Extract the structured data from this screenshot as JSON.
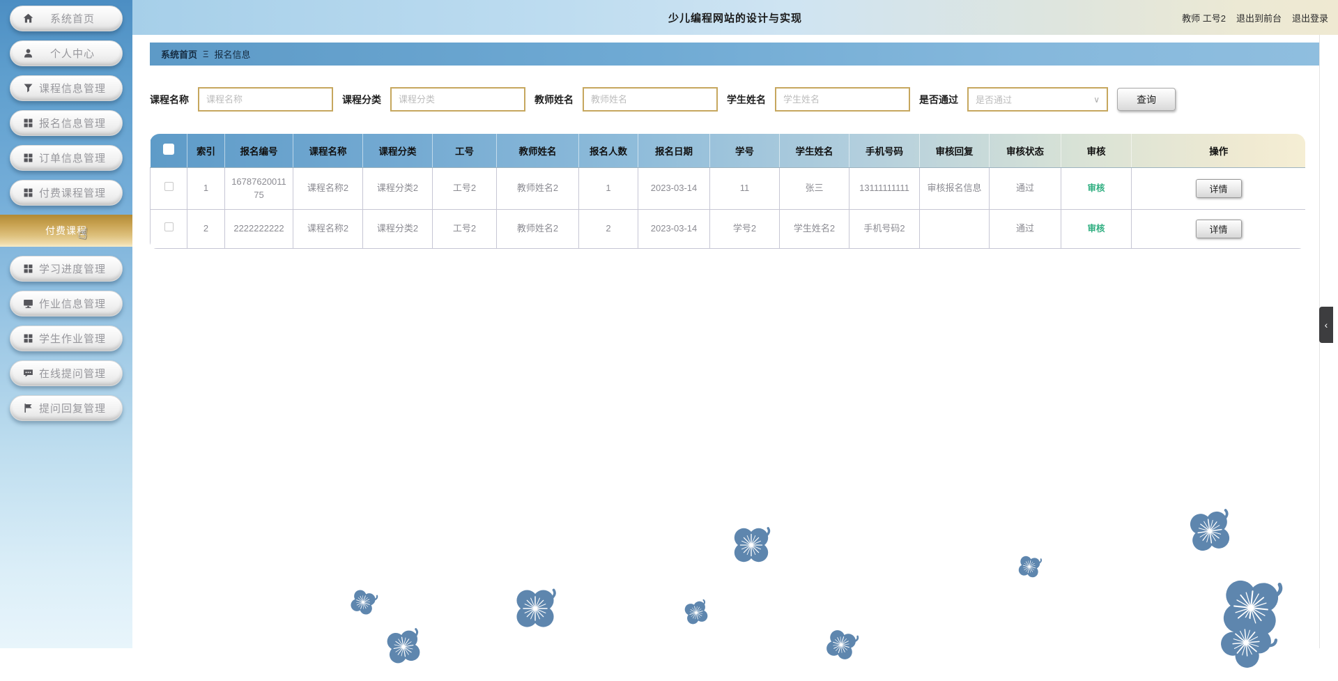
{
  "app": {
    "title": "少儿编程网站的设计与实现"
  },
  "header": {
    "user_label": "教师 工号2",
    "exit_front_label": "退出到前台",
    "logout_label": "退出登录"
  },
  "sidebar": {
    "items": [
      {
        "label": "系统首页",
        "icon": "home-icon"
      },
      {
        "label": "个人中心",
        "icon": "user-icon"
      },
      {
        "label": "课程信息管理",
        "icon": "filter-icon"
      },
      {
        "label": "报名信息管理",
        "icon": "grid-icon"
      },
      {
        "label": "订单信息管理",
        "icon": "grid-icon"
      },
      {
        "label": "付费课程管理",
        "icon": "grid-icon"
      },
      {
        "label": "学习进度管理",
        "icon": "grid-icon"
      },
      {
        "label": "作业信息管理",
        "icon": "monitor-icon"
      },
      {
        "label": "学生作业管理",
        "icon": "grid-icon"
      },
      {
        "label": "在线提问管理",
        "icon": "chat-icon"
      },
      {
        "label": "提问回复管理",
        "icon": "flag-icon"
      }
    ],
    "active_item": {
      "label": "付费课程"
    }
  },
  "breadcrumb": {
    "home": "系统首页",
    "separator": "Ξ",
    "current": "报名信息"
  },
  "filters": {
    "fields": [
      {
        "label": "课程名称",
        "placeholder": "课程名称",
        "type": "input"
      },
      {
        "label": "课程分类",
        "placeholder": "课程分类",
        "type": "input"
      },
      {
        "label": "教师姓名",
        "placeholder": "教师姓名",
        "type": "input"
      },
      {
        "label": "学生姓名",
        "placeholder": "学生姓名",
        "type": "input"
      },
      {
        "label": "是否通过",
        "placeholder": "是否通过",
        "type": "select"
      }
    ],
    "search_label": "查询"
  },
  "table": {
    "headers": [
      "索引",
      "报名编号",
      "课程名称",
      "课程分类",
      "工号",
      "教师姓名",
      "报名人数",
      "报名日期",
      "学号",
      "学生姓名",
      "手机号码",
      "审核回复",
      "审核状态",
      "审核",
      "操作"
    ],
    "rows": [
      {
        "cells": [
          "1",
          "1678762001175",
          "课程名称2",
          "课程分类2",
          "工号2",
          "教师姓名2",
          "1",
          "2023-03-14",
          "11",
          "张三",
          "13111111111",
          "审核报名信息",
          "通过"
        ]
      },
      {
        "cells": [
          "2",
          "2222222222",
          "课程名称2",
          "课程分类2",
          "工号2",
          "教师姓名2",
          "2",
          "2023-03-14",
          "学号2",
          "学生姓名2",
          "手机号码2",
          "",
          "通过"
        ]
      }
    ],
    "audit_label": "审核",
    "detail_label": "详情"
  },
  "colors": {
    "sidebar_top_blue": "#4c8ec3",
    "active_gold": "#c8a251",
    "breadcrumb_blue": "#5d9ac7",
    "table_header_blue": "#5e9bc8",
    "table_header_cream": "#f5eed4",
    "input_border_gold": "#c6a75e",
    "audit_green": "#2fae80",
    "flower_blue": "#5e86ae",
    "collapse_tab_dark": "#3d3d3f"
  }
}
